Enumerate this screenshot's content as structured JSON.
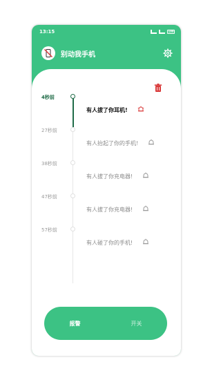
{
  "status_bar": {
    "time": "13:15",
    "battery": "100"
  },
  "app_bar": {
    "title": "别动我手机"
  },
  "timeline": [
    {
      "time": "4秒前",
      "message": "有人拔了你耳机!",
      "active": true
    },
    {
      "time": "27秒前",
      "message": "有人抬起了你的手机!",
      "active": false
    },
    {
      "time": "38秒前",
      "message": "有人拔了你充电器!",
      "active": false
    },
    {
      "time": "47秒前",
      "message": "有人拔了你充电器!",
      "active": false
    },
    {
      "time": "57秒前",
      "message": "有人碰了你的手机!",
      "active": false
    }
  ],
  "bottom_toggle": {
    "alarm_label": "报警",
    "switch_label": "开关"
  },
  "colors": {
    "primary": "#3cc284",
    "dark_green": "#1f6b47",
    "alert_red": "#d93a3a"
  }
}
